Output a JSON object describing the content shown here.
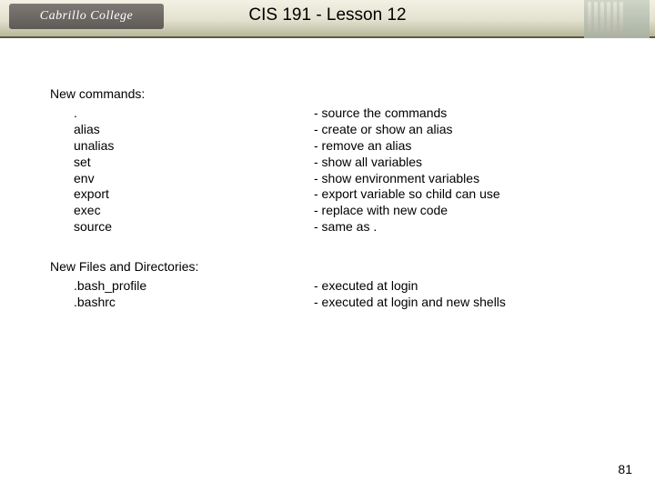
{
  "header": {
    "logo_text": "Cabrillo College",
    "title": "CIS 191 - Lesson 12"
  },
  "sections": [
    {
      "title": "New commands:",
      "items": [
        {
          "cmd": ".",
          "desc": "- source the commands"
        },
        {
          "cmd": "alias",
          "desc": "- create or show an alias"
        },
        {
          "cmd": "unalias",
          "desc": "- remove an alias"
        },
        {
          "cmd": "set",
          "desc": "- show all variables"
        },
        {
          "cmd": "env",
          "desc": "- show environment variables"
        },
        {
          "cmd": "export",
          "desc": "- export variable so child can use"
        },
        {
          "cmd": "exec",
          "desc": "- replace with new code"
        },
        {
          "cmd": "source",
          "desc": "- same as ."
        }
      ]
    },
    {
      "title": "New Files and Directories:",
      "items": [
        {
          "cmd": ".bash_profile",
          "desc": "- executed at login"
        },
        {
          "cmd": ".bashrc",
          "desc": "- executed at login and new shells"
        }
      ]
    }
  ],
  "page_number": "81"
}
